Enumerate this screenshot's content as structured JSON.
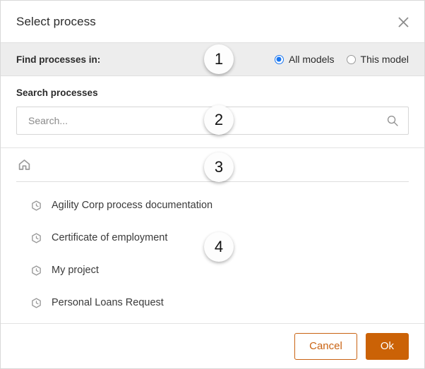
{
  "dialog": {
    "title": "Select process",
    "close_icon": "close-icon"
  },
  "find_bar": {
    "label": "Find processes in:",
    "options": [
      {
        "label": "All models",
        "selected": true
      },
      {
        "label": "This model",
        "selected": false
      }
    ]
  },
  "search": {
    "heading": "Search processes",
    "placeholder": "Search...",
    "value": "",
    "icon": "search-icon"
  },
  "browser": {
    "breadcrumb": {
      "home_icon": "home-icon"
    },
    "items": [
      {
        "icon": "process-icon",
        "label": "Agility Corp process documentation"
      },
      {
        "icon": "process-icon",
        "label": "Certificate of employment"
      },
      {
        "icon": "process-icon",
        "label": "My project"
      },
      {
        "icon": "process-icon",
        "label": "Personal Loans Request"
      }
    ]
  },
  "footer": {
    "cancel_label": "Cancel",
    "ok_label": "Ok"
  },
  "callouts": [
    {
      "number": "1"
    },
    {
      "number": "2"
    },
    {
      "number": "3"
    },
    {
      "number": "4"
    }
  ],
  "colors": {
    "accent_orange": "#cb6206",
    "radio_blue": "#1976f0",
    "strip_gray": "#ededed",
    "border_gray": "#d9d9d9"
  }
}
